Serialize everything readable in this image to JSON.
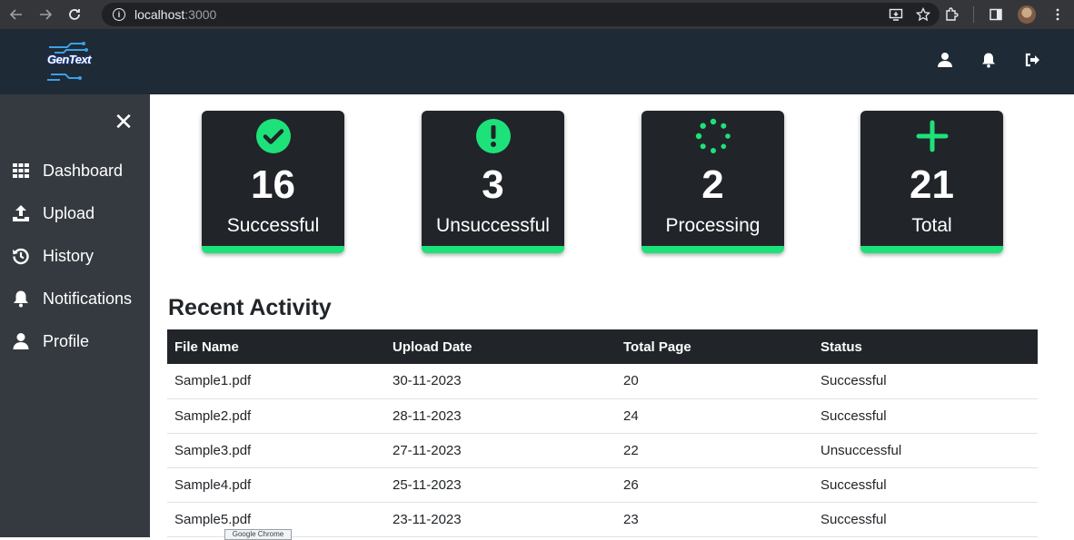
{
  "browser": {
    "url_host": "localhost",
    "url_port": ":3000"
  },
  "app": {
    "logo_text": "GenText"
  },
  "sidebar": {
    "close_label": "✕",
    "items": [
      {
        "label": "Dashboard",
        "icon": "grid-icon"
      },
      {
        "label": "Upload",
        "icon": "upload-icon"
      },
      {
        "label": "History",
        "icon": "history-icon"
      },
      {
        "label": "Notifications",
        "icon": "bell-icon"
      },
      {
        "label": "Profile",
        "icon": "user-icon"
      }
    ]
  },
  "stats": [
    {
      "count": "16",
      "label": "Successful",
      "icon": "check-circle-icon"
    },
    {
      "count": "3",
      "label": "Unsuccessful",
      "icon": "exclamation-circle-icon"
    },
    {
      "count": "2",
      "label": "Processing",
      "icon": "spinner-icon"
    },
    {
      "count": "21",
      "label": "Total",
      "icon": "plus-icon"
    }
  ],
  "colors": {
    "accent": "#1de27a",
    "card_bg": "#212529",
    "sidebar_bg": "#343a40",
    "header_bg": "#1e2a35"
  },
  "recent": {
    "title": "Recent Activity",
    "columns": [
      "File Name",
      "Upload Date",
      "Total Page",
      "Status"
    ],
    "rows": [
      [
        "Sample1.pdf",
        "30-11-2023",
        "20",
        "Successful"
      ],
      [
        "Sample2.pdf",
        "28-11-2023",
        "24",
        "Successful"
      ],
      [
        "Sample3.pdf",
        "27-11-2023",
        "22",
        "Unsuccessful"
      ],
      [
        "Sample4.pdf",
        "25-11-2023",
        "26",
        "Successful"
      ],
      [
        "Sample5.pdf",
        "23-11-2023",
        "23",
        "Successful"
      ]
    ]
  },
  "tooltip": "Google Chrome"
}
